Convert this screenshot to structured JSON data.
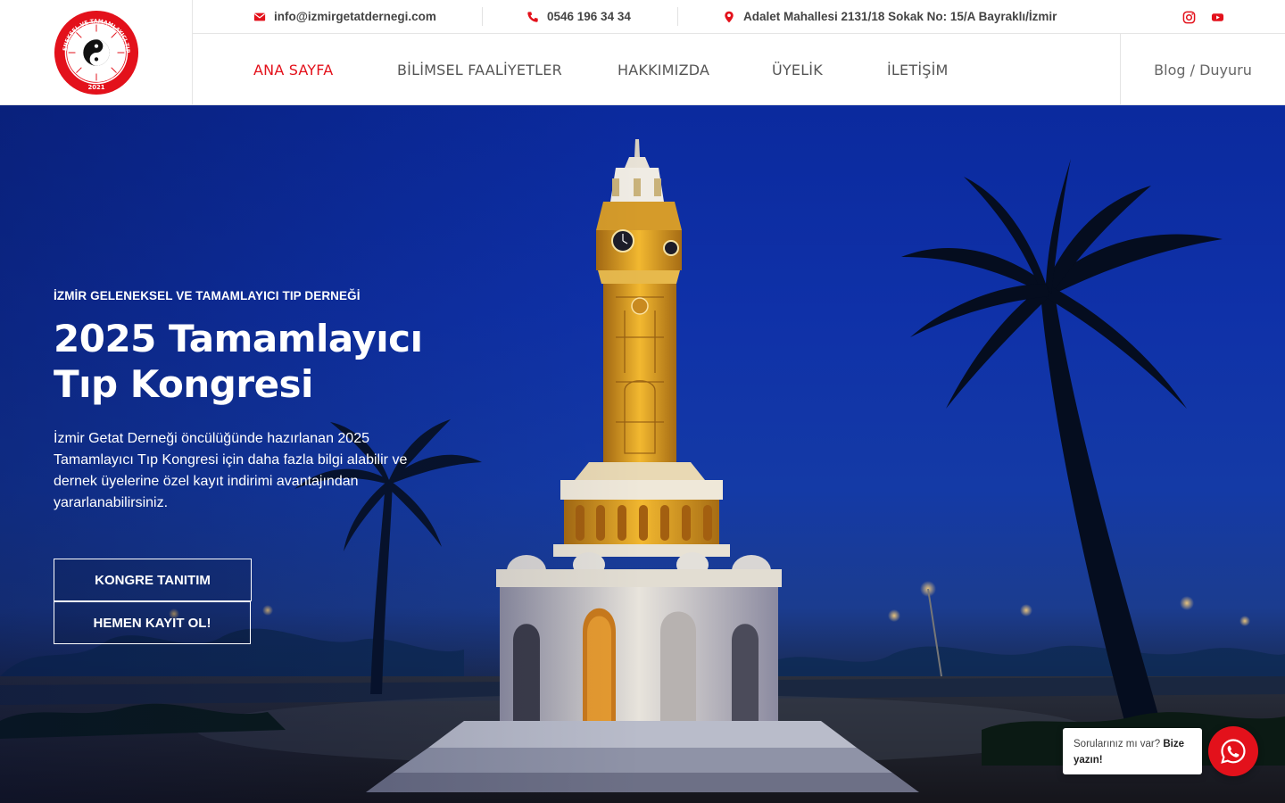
{
  "topbar": {
    "email": "info@izmirgetatdernegi.com",
    "phone": "0546 196 34 34",
    "address": "Adalet Mahallesi 2131/18 Sokak No: 15/A Bayraklı/İzmir"
  },
  "logo": {
    "text": "İZMİR GELENEKSEL VE TAMAMLAYICI TIP DERNEĞİ",
    "year": "2021"
  },
  "nav": {
    "items": [
      {
        "label": "ANA SAYFA",
        "active": true
      },
      {
        "label": "BİLİMSEL FAALİYETLER",
        "active": false
      },
      {
        "label": "HAKKIMIZDA",
        "active": false
      },
      {
        "label": "ÜYELİK",
        "active": false
      },
      {
        "label": "İLETİŞİM",
        "active": false
      }
    ],
    "blog_label": "Blog / Duyuru"
  },
  "hero": {
    "kicker": "İZMİR GELENEKSEL VE TAMAMLAYICI TIP DERNEĞİ",
    "title": "2025 Tamamlayıcı Tıp Kongresi",
    "description": "İzmir Getat Derneği öncülüğünde hazırlanan 2025 Tamamlayıcı Tıp Kongresi için daha fazla bilgi alabilir ve dernek üyelerine özel kayıt indirimi avantajından yararlanabilirsiniz.",
    "button_primary": "KONGRE TANITIM",
    "button_secondary": "HEMEN KAYIT OL!"
  },
  "whatsapp": {
    "prompt": "Sorularınız mı var?",
    "cta": "Bize yazın!"
  },
  "colors": {
    "accent": "#e3111b",
    "nav_text": "#555555",
    "sky": "#0f31a8"
  },
  "icons": [
    "envelope-icon",
    "phone-icon",
    "map-pin-icon",
    "instagram-icon",
    "youtube-icon",
    "whatsapp-icon"
  ]
}
